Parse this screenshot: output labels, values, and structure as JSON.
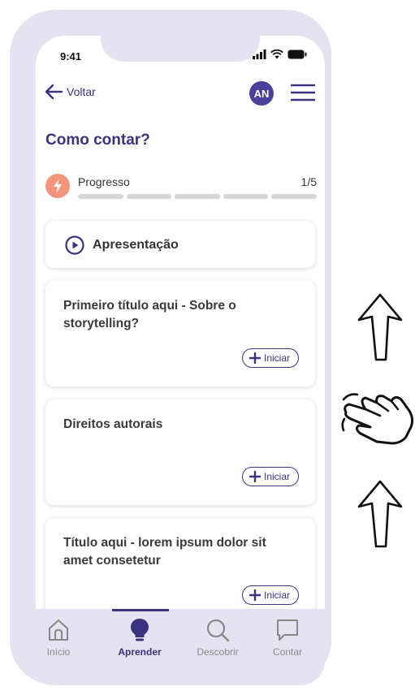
{
  "status_bar": {
    "time": "9:41"
  },
  "header": {
    "back_label": "Voltar",
    "avatar_initials": "AN"
  },
  "page": {
    "title": "Como contar?"
  },
  "progress": {
    "label": "Progresso",
    "count": "1/5",
    "current": 1,
    "total": 5
  },
  "intro_card": {
    "label": "Apresentação"
  },
  "lessons": [
    {
      "title": "Primeiro título aqui - Sobre o storytelling?",
      "button_label": "Iniciar"
    },
    {
      "title": "Direitos autorais",
      "button_label": "Iniciar"
    },
    {
      "title": "Título aqui - lorem ipsum dolor sit amet consetetur",
      "button_label": "Iniciar"
    }
  ],
  "bottom_nav": {
    "items": [
      {
        "label": "Início",
        "icon": "home-icon",
        "active": false
      },
      {
        "label": "Aprender",
        "icon": "lightbulb-icon",
        "active": true
      },
      {
        "label": "Descobrir",
        "icon": "search-icon",
        "active": false
      },
      {
        "label": "Contar",
        "icon": "chat-bubble-icon",
        "active": false
      }
    ]
  },
  "gestures": [
    "swipe-up-arrow-icon",
    "hand-swipe-icon",
    "swipe-up-arrow-icon"
  ],
  "colors": {
    "primary": "#3b3280",
    "accent": "#f4947c",
    "frame": "#e5e3f1"
  }
}
